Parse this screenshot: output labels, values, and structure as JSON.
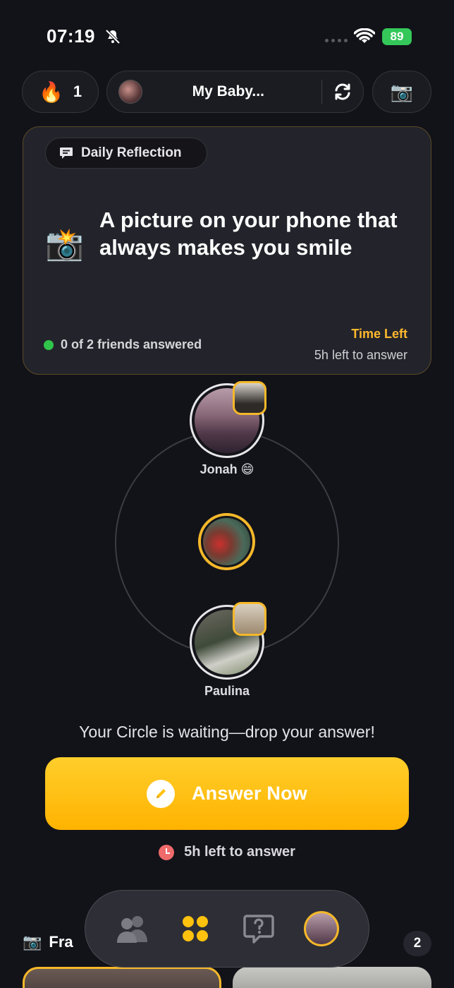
{
  "status_bar": {
    "time": "07:19",
    "battery": "89"
  },
  "header": {
    "streak_count": "1",
    "circle_name": "My Baby...",
    "icons": [
      "fire-icon",
      "refresh-icon",
      "camera-icon"
    ]
  },
  "reflection": {
    "tag_label": "Daily Reflection",
    "prompt": "A picture on your phone that always makes you smile",
    "answered_text": "0 of 2 friends answered",
    "time_left_label": "Time Left",
    "time_left_value": "5h left to answer"
  },
  "circle": {
    "friends": [
      {
        "name": "Jonah 😄"
      },
      {
        "name": "Paulina"
      }
    ]
  },
  "cta": {
    "waiting_text": "Your Circle is waiting—drop your answer!",
    "button_label": "Answer Now",
    "timer_text": "5h left to answer"
  },
  "feed": {
    "section_title": "Fra",
    "count": "2"
  },
  "tabbar": {
    "tabs": [
      "friends-icon",
      "grid-icon",
      "question-icon",
      "profile-avatar"
    ]
  },
  "colors": {
    "accent": "#ffb92e",
    "button": "#ffc20e",
    "background": "#121219",
    "card": "#23242b",
    "online": "#30c54a"
  }
}
